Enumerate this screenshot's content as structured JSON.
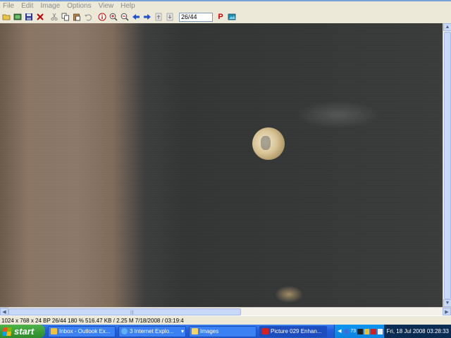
{
  "menu": [
    "File",
    "Edit",
    "Image",
    "Options",
    "View",
    "Help"
  ],
  "toolbar": {
    "page_value": "26/44",
    "icons": [
      "open-icon",
      "thumbnails-icon",
      "save-icon",
      "delete-icon",
      "cut-icon",
      "copy-icon",
      "paste-icon",
      "undo-icon",
      "info-icon",
      "zoom-in-icon",
      "zoom-out-icon",
      "previous-icon",
      "next-icon",
      "first-icon",
      "last-icon",
      "print-icon",
      "acquire-icon"
    ],
    "colors": {
      "delete": "#c00000",
      "info": "#d00000",
      "print": "#d00000",
      "nav": "#1f55cc"
    }
  },
  "status": {
    "text": "1024 x 768 x 24 BP 26/44  180 % 516.47 KB / 2.25 M 7/18/2008 / 03:19:4"
  },
  "taskbar": {
    "start_label": "start",
    "tasks": [
      {
        "label": "Inbox - Outlook Ex...",
        "icon": "outlook-icon"
      },
      {
        "label": "3 Internet Explo...",
        "icon": "internet-explorer-icon",
        "dropdown": "▾"
      },
      {
        "label": "Images",
        "icon": "folder-icon"
      },
      {
        "label": "Picture 029 Enhan...",
        "icon": "irfanview-icon",
        "active": true
      }
    ],
    "tray_number": "73",
    "clock": "Fri, 18 Jul 2008 03:28:33"
  }
}
